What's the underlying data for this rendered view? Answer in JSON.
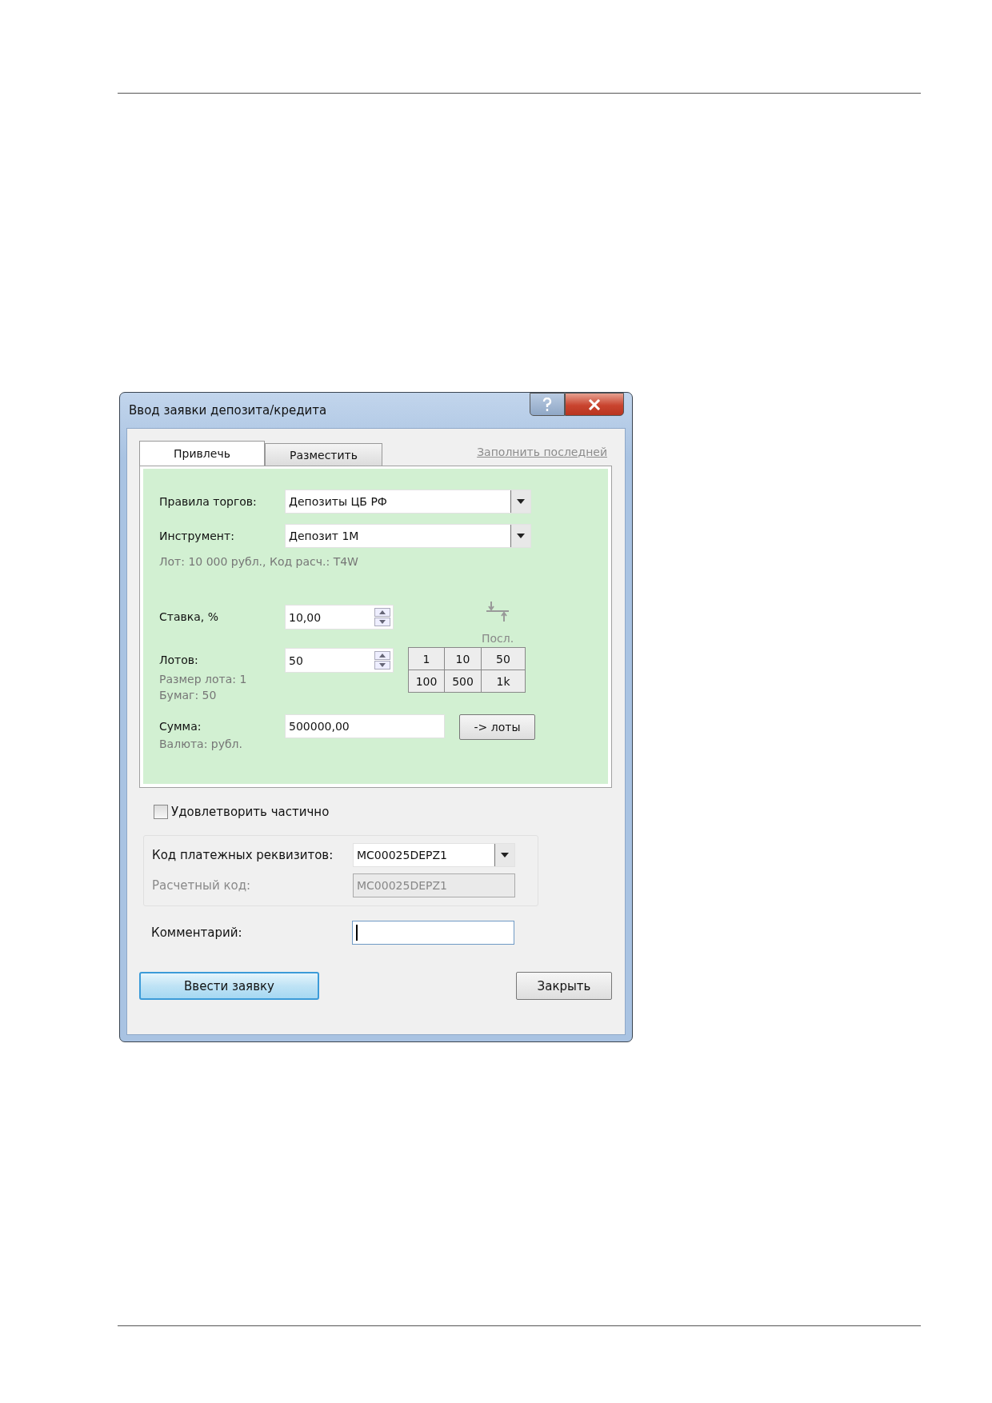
{
  "window": {
    "title": "Ввод заявки депозита/кредита"
  },
  "tabs": [
    {
      "label": "Привлечь",
      "selected": true
    },
    {
      "label": "Разместить",
      "selected": false
    }
  ],
  "fill_last_link": "Заполнить последней",
  "trade_rules": {
    "label": "Правила торгов:",
    "value": "Депозиты ЦБ РФ"
  },
  "instrument": {
    "label": "Инструмент:",
    "value": "Депозит 1М",
    "info": "Лот: 10 000 рубл., Код расч.: T4W"
  },
  "rate": {
    "label": "Ставка, %",
    "value": "10,00",
    "last_label": "Посл."
  },
  "lots": {
    "label": "Лотов:",
    "value": "50",
    "info": [
      "Размер лота: 1",
      "Бумаг: 50"
    ],
    "quick_buttons": [
      "1",
      "10",
      "50",
      "100",
      "500",
      "1k"
    ]
  },
  "sum": {
    "label": "Сумма:",
    "value": "500000,00",
    "info": "Валюта: рубл.",
    "convert_button": "-> лоты"
  },
  "partial": {
    "label": "Удовлетворить частично",
    "checked": false
  },
  "payment": {
    "label": "Код платежных реквизитов:",
    "value": "MC00025DEPZ1"
  },
  "settlement": {
    "label": "Расчетный код:",
    "value": "MC00025DEPZ1",
    "disabled": true
  },
  "comment": {
    "label": "Комментарий:"
  },
  "buttons": [
    {
      "label": "Ввести заявку",
      "default": true
    },
    {
      "label": "Закрыть",
      "default": false
    }
  ]
}
